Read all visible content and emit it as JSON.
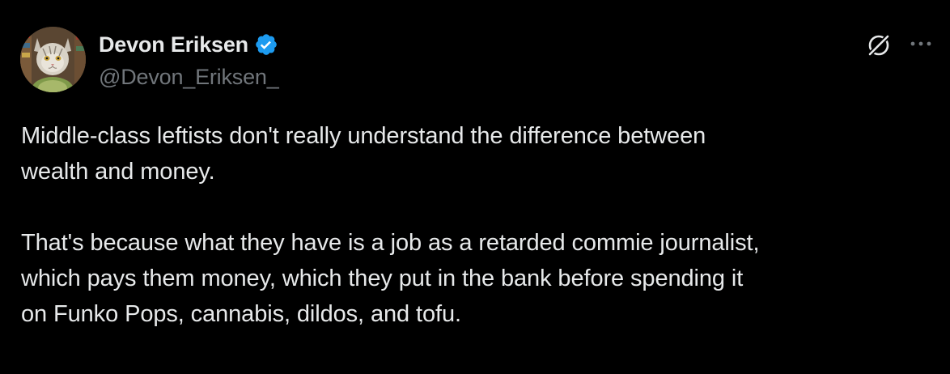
{
  "author": {
    "name": "Devon Eriksen",
    "handle": "@Devon_Eriksen_",
    "verified": true
  },
  "icons": {
    "avatar": "cat-avatar",
    "verified": "verified-badge-icon",
    "grok": "grok-icon",
    "more": "more-options-icon"
  },
  "tweet": {
    "paragraph_1_line_1": "Middle-class leftists don't really understand the difference between",
    "paragraph_1_line_2": "wealth and money.",
    "paragraph_2_line_1": "That's because what they have is a job as a retarded commie journalist,",
    "paragraph_2_line_2": "which pays them money, which they put in the bank before spending it",
    "paragraph_2_line_3": "on Funko Pops, cannabis, dildos, and tofu."
  },
  "colors": {
    "background": "#000000",
    "text_primary": "#e7e9ea",
    "text_secondary": "#71767b",
    "verified_blue": "#1d9bf0"
  }
}
